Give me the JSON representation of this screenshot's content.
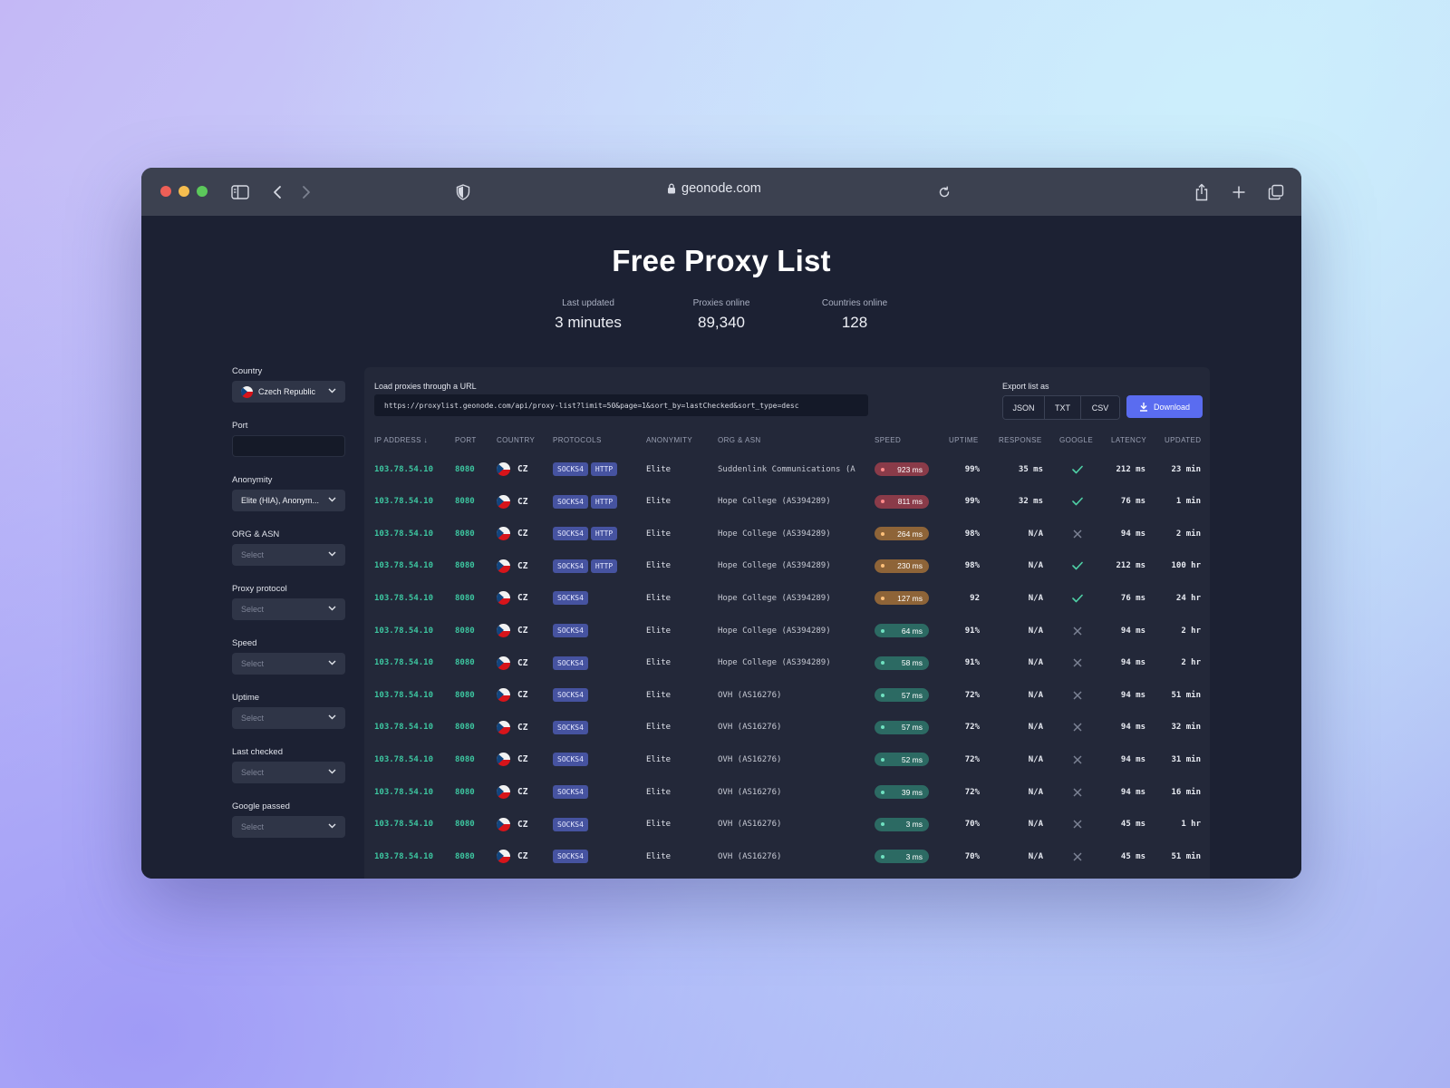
{
  "browser": {
    "url": "geonode.com"
  },
  "header": {
    "title": "Free Proxy List",
    "stats": [
      {
        "label": "Last updated",
        "value": "3 minutes"
      },
      {
        "label": "Proxies online",
        "value": "89,340"
      },
      {
        "label": "Countries online",
        "value": "128"
      }
    ]
  },
  "filters": {
    "country": {
      "label": "Country",
      "value": "Czech Republic"
    },
    "port": {
      "label": "Port",
      "value": ""
    },
    "anonymity": {
      "label": "Anonymity",
      "value": "Elite (HIA), Anonym..."
    },
    "org_asn": {
      "label": "ORG & ASN",
      "placeholder": "Select"
    },
    "protocol": {
      "label": "Proxy protocol",
      "placeholder": "Select"
    },
    "speed": {
      "label": "Speed",
      "placeholder": "Select"
    },
    "uptime": {
      "label": "Uptime",
      "placeholder": "Select"
    },
    "last_checked": {
      "label": "Last checked",
      "placeholder": "Select"
    },
    "google": {
      "label": "Google passed",
      "placeholder": "Select"
    }
  },
  "load_url": {
    "label": "Load proxies through a URL",
    "value": "https://proxylist.geonode.com/api/proxy-list?limit=50&page=1&sort_by=lastChecked&sort_type=desc"
  },
  "export": {
    "label": "Export list as",
    "formats": [
      "JSON",
      "TXT",
      "CSV"
    ],
    "download": "Download"
  },
  "table": {
    "columns": [
      "IP ADDRESS",
      "PORT",
      "COUNTRY",
      "PROTOCOLS",
      "ANONYMITY",
      "ORG & ASN",
      "SPEED",
      "UPTIME",
      "RESPONSE",
      "GOOGLE",
      "LATENCY",
      "UPDATED"
    ],
    "rows": [
      {
        "ip": "103.78.54.10",
        "port": "8080",
        "country": "CZ",
        "protocols": [
          "SOCKS4",
          "HTTP"
        ],
        "anonymity": "Elite",
        "org": "Suddenlink Communications (A",
        "speed": "923 ms",
        "speed_level": "red",
        "uptime": "99%",
        "response": "35 ms",
        "google": true,
        "latency": "212 ms",
        "updated": "23 min"
      },
      {
        "ip": "103.78.54.10",
        "port": "8080",
        "country": "CZ",
        "protocols": [
          "SOCKS4",
          "HTTP"
        ],
        "anonymity": "Elite",
        "org": "Hope College (AS394289)",
        "speed": "811 ms",
        "speed_level": "red",
        "uptime": "99%",
        "response": "32 ms",
        "google": true,
        "latency": "76 ms",
        "updated": "1 min"
      },
      {
        "ip": "103.78.54.10",
        "port": "8080",
        "country": "CZ",
        "protocols": [
          "SOCKS4",
          "HTTP"
        ],
        "anonymity": "Elite",
        "org": "Hope College (AS394289)",
        "speed": "264 ms",
        "speed_level": "orange",
        "uptime": "98%",
        "response": "N/A",
        "google": false,
        "latency": "94 ms",
        "updated": "2 min"
      },
      {
        "ip": "103.78.54.10",
        "port": "8080",
        "country": "CZ",
        "protocols": [
          "SOCKS4",
          "HTTP"
        ],
        "anonymity": "Elite",
        "org": "Hope College (AS394289)",
        "speed": "230 ms",
        "speed_level": "orange",
        "uptime": "98%",
        "response": "N/A",
        "google": true,
        "latency": "212 ms",
        "updated": "100 hr"
      },
      {
        "ip": "103.78.54.10",
        "port": "8080",
        "country": "CZ",
        "protocols": [
          "SOCKS4"
        ],
        "anonymity": "Elite",
        "org": "Hope College (AS394289)",
        "speed": "127 ms",
        "speed_level": "orange",
        "uptime": "92",
        "response": "N/A",
        "google": true,
        "latency": "76 ms",
        "updated": "24 hr"
      },
      {
        "ip": "103.78.54.10",
        "port": "8080",
        "country": "CZ",
        "protocols": [
          "SOCKS4"
        ],
        "anonymity": "Elite",
        "org": "Hope College (AS394289)",
        "speed": "64 ms",
        "speed_level": "green",
        "uptime": "91%",
        "response": "N/A",
        "google": false,
        "latency": "94 ms",
        "updated": "2 hr"
      },
      {
        "ip": "103.78.54.10",
        "port": "8080",
        "country": "CZ",
        "protocols": [
          "SOCKS4"
        ],
        "anonymity": "Elite",
        "org": "Hope College (AS394289)",
        "speed": "58 ms",
        "speed_level": "green",
        "uptime": "91%",
        "response": "N/A",
        "google": false,
        "latency": "94 ms",
        "updated": "2 hr"
      },
      {
        "ip": "103.78.54.10",
        "port": "8080",
        "country": "CZ",
        "protocols": [
          "SOCKS4"
        ],
        "anonymity": "Elite",
        "org": "OVH (AS16276)",
        "speed": "57 ms",
        "speed_level": "green",
        "uptime": "72%",
        "response": "N/A",
        "google": false,
        "latency": "94 ms",
        "updated": "51 min"
      },
      {
        "ip": "103.78.54.10",
        "port": "8080",
        "country": "CZ",
        "protocols": [
          "SOCKS4"
        ],
        "anonymity": "Elite",
        "org": "OVH (AS16276)",
        "speed": "57 ms",
        "speed_level": "green",
        "uptime": "72%",
        "response": "N/A",
        "google": false,
        "latency": "94 ms",
        "updated": "32 min"
      },
      {
        "ip": "103.78.54.10",
        "port": "8080",
        "country": "CZ",
        "protocols": [
          "SOCKS4"
        ],
        "anonymity": "Elite",
        "org": "OVH (AS16276)",
        "speed": "52 ms",
        "speed_level": "green",
        "uptime": "72%",
        "response": "N/A",
        "google": false,
        "latency": "94 ms",
        "updated": "31 min"
      },
      {
        "ip": "103.78.54.10",
        "port": "8080",
        "country": "CZ",
        "protocols": [
          "SOCKS4"
        ],
        "anonymity": "Elite",
        "org": "OVH (AS16276)",
        "speed": "39 ms",
        "speed_level": "green",
        "uptime": "72%",
        "response": "N/A",
        "google": false,
        "latency": "94 ms",
        "updated": "16 min"
      },
      {
        "ip": "103.78.54.10",
        "port": "8080",
        "country": "CZ",
        "protocols": [
          "SOCKS4"
        ],
        "anonymity": "Elite",
        "org": "OVH (AS16276)",
        "speed": "3 ms",
        "speed_level": "green",
        "uptime": "70%",
        "response": "N/A",
        "google": false,
        "latency": "45 ms",
        "updated": "1 hr"
      },
      {
        "ip": "103.78.54.10",
        "port": "8080",
        "country": "CZ",
        "protocols": [
          "SOCKS4"
        ],
        "anonymity": "Elite",
        "org": "OVH (AS16276)",
        "speed": "3 ms",
        "speed_level": "green",
        "uptime": "70%",
        "response": "N/A",
        "google": false,
        "latency": "45 ms",
        "updated": "51 min"
      }
    ]
  }
}
